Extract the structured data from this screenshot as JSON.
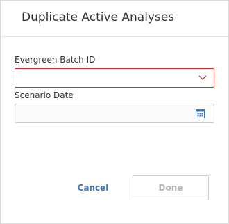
{
  "dialog": {
    "title": "Duplicate Active Analyses"
  },
  "form": {
    "batch_id": {
      "label": "Evergreen Batch ID",
      "value": "",
      "icon": "chevron-down-icon"
    },
    "scenario_date": {
      "label": "Scenario Date",
      "value": "",
      "icon": "calendar-icon"
    }
  },
  "actions": {
    "cancel_label": "Cancel",
    "done_label": "Done"
  },
  "colors": {
    "accent": "#3b73b9",
    "error_border": "#c9302c",
    "disabled_text": "#b5b5b5"
  }
}
